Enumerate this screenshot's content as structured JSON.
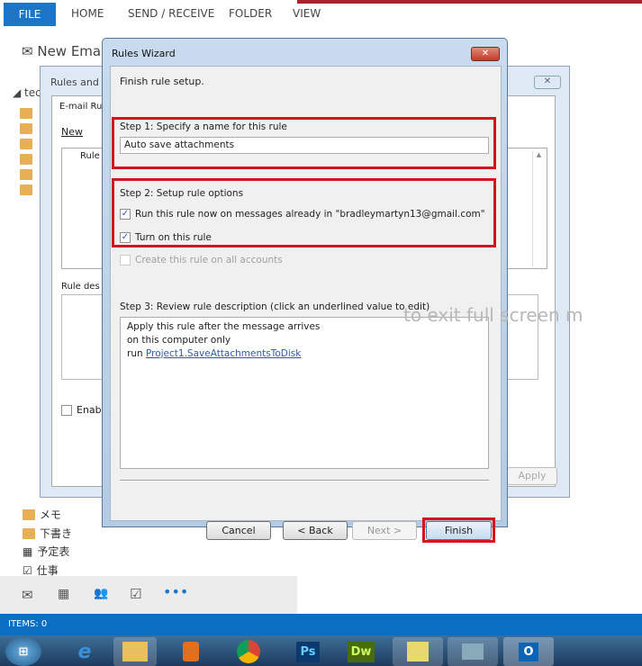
{
  "ribbon": {
    "tabs": [
      "FILE",
      "HOME",
      "SEND / RECEIVE",
      "FOLDER",
      "VIEW"
    ]
  },
  "outlook": {
    "new_email": "New Ema",
    "account": "tec",
    "folders_jp": [
      "メモ",
      "下書き",
      "予定表",
      "仕事"
    ],
    "status": "ITEMS: 0",
    "overlay_hint": "to exit full screen m"
  },
  "rules_alerts": {
    "title": "Rules and A",
    "tab": "E-mail Ru",
    "new_button": "New",
    "column_rule": "Rule",
    "desc_label": "Rule des",
    "enable_label": "Enabl",
    "apply": "Apply"
  },
  "wizard": {
    "title": "Rules Wizard",
    "heading": "Finish rule setup.",
    "step1_label": "Step 1: Specify a name for this rule",
    "rule_name": "Auto save attachments",
    "step2_label": "Step 2: Setup rule options",
    "opt_run_now": "Run this rule now on messages already in \"bradleymartyn13@gmail.com\"",
    "opt_run_now_checked": true,
    "opt_turn_on": "Turn on this rule",
    "opt_turn_on_checked": true,
    "opt_all_accounts": "Create this rule on all accounts",
    "opt_all_accounts_checked": false,
    "step3_label": "Step 3: Review rule description (click an underlined value to edit)",
    "desc_line1": "Apply this rule after the message arrives",
    "desc_line2": "on this computer only",
    "desc_run": "run",
    "desc_link": "Project1.SaveAttachmentsToDisk",
    "cancel": "Cancel",
    "back": "< Back",
    "next": "Next >",
    "finish": "Finish"
  },
  "taskbar": {
    "apps": [
      "start",
      "internet-explorer",
      "file-explorer",
      "media-player",
      "chrome",
      "Ps",
      "Dw",
      "sticky-notes",
      "remote-desktop",
      "outlook"
    ],
    "ps": "Ps",
    "dw": "Dw",
    "outlook": "O"
  },
  "colors": {
    "accent": "#1e74c6",
    "highlight": "#d6141c"
  }
}
